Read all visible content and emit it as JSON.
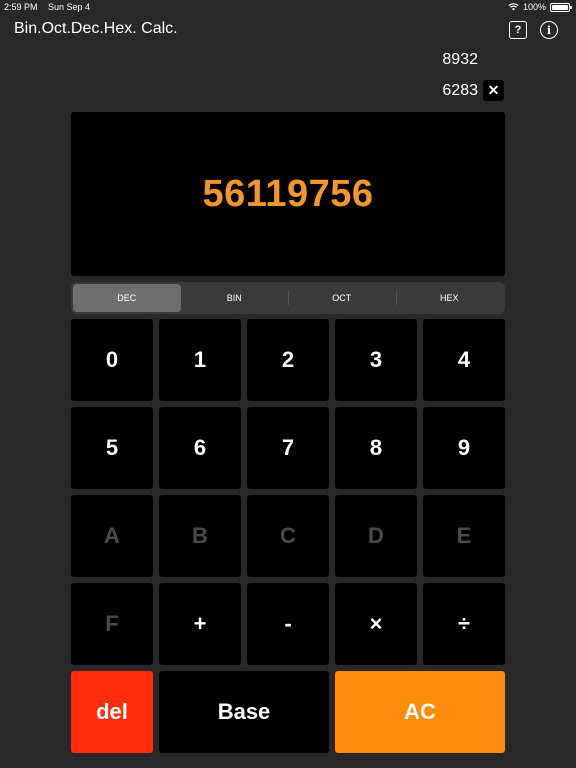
{
  "status": {
    "time": "2:59 PM",
    "date": "Sun Sep 4",
    "battery": "100%"
  },
  "app": {
    "title": "Bin.Oct.Dec.Hex. Calc.",
    "help_label": "?",
    "info_label": "i"
  },
  "history": {
    "entries": [
      "8932",
      "6283"
    ],
    "clear_label": "✕"
  },
  "display": {
    "value": "56119756",
    "color": "#f5962a"
  },
  "modes": {
    "items": [
      "DEC",
      "BIN",
      "OCT",
      "HEX"
    ],
    "selected": "DEC"
  },
  "keypad": {
    "rows": [
      [
        "0",
        "1",
        "2",
        "3",
        "4"
      ],
      [
        "5",
        "6",
        "7",
        "8",
        "9"
      ],
      [
        "A",
        "B",
        "C",
        "D",
        "E"
      ],
      [
        "F",
        "+",
        "-",
        "×",
        "÷"
      ]
    ],
    "disabled_keys": [
      "A",
      "B",
      "C",
      "D",
      "E",
      "F"
    ]
  },
  "actions": {
    "del": "del",
    "base": "Base",
    "ac": "AC"
  },
  "colors": {
    "background": "#282828",
    "key": "#000000",
    "del": "#ff2b0d",
    "ac": "#ff8c0a",
    "disabled_text": "#4a4a4a"
  }
}
